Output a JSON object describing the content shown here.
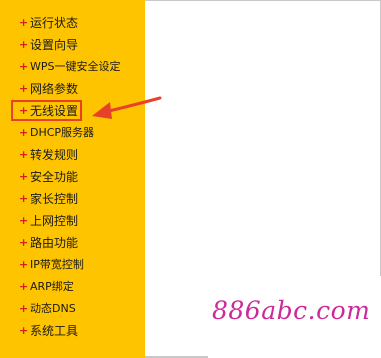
{
  "sidebar": {
    "items": [
      {
        "label": "运行状态"
      },
      {
        "label": "设置向导"
      },
      {
        "label": "WPS一键安全设定"
      },
      {
        "label": "网络参数"
      },
      {
        "label": "无线设置"
      },
      {
        "label": "DHCP服务器"
      },
      {
        "label": "转发规则"
      },
      {
        "label": "安全功能"
      },
      {
        "label": "家长控制"
      },
      {
        "label": "上网控制"
      },
      {
        "label": "路由功能"
      },
      {
        "label": "IP带宽控制"
      },
      {
        "label": "ARP绑定"
      },
      {
        "label": "动态DNS"
      },
      {
        "label": "系统工具"
      }
    ],
    "bullet": "+",
    "highlighted_item": "无线设置",
    "background_color": "#ffc400"
  },
  "watermark": {
    "text": "886abc.com",
    "color": "#cc2a98"
  },
  "annotation_color": "#e8412a"
}
